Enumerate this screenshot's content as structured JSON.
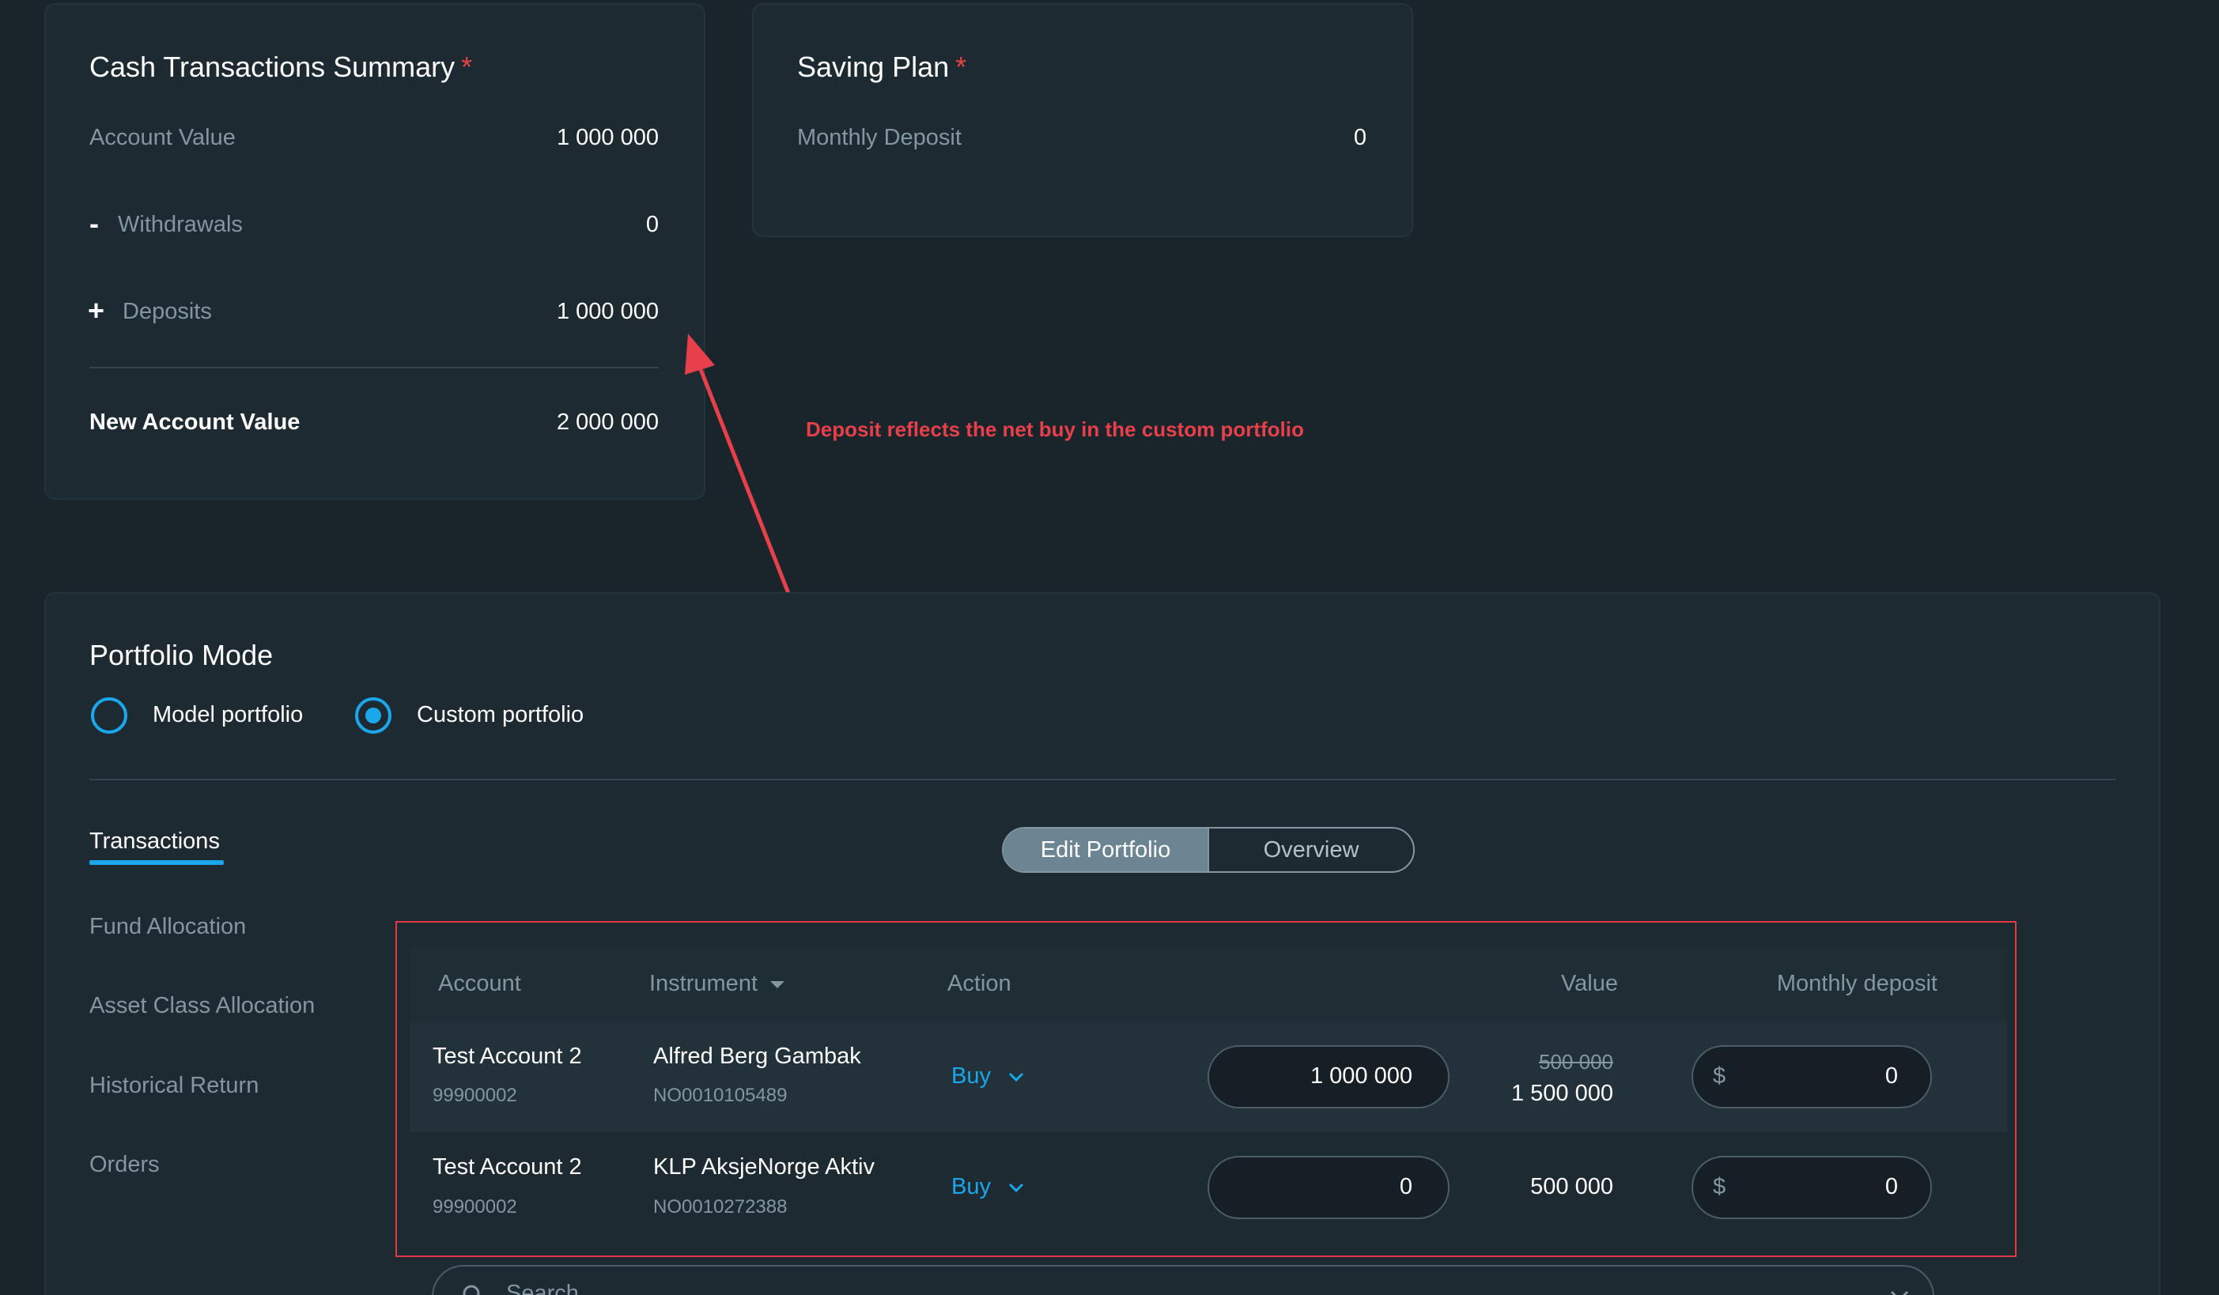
{
  "cash_summary": {
    "title": "Cash Transactions Summary",
    "required_mark": "*",
    "account_value_label": "Account Value",
    "account_value": "1 000 000",
    "withdrawals_sign": "-",
    "withdrawals_label": "Withdrawals",
    "withdrawals_value": "0",
    "deposits_sign": "+",
    "deposits_label": "Deposits",
    "deposits_value": "1 000 000",
    "new_account_value_label": "New Account Value",
    "new_account_value": "2 000 000"
  },
  "saving_plan": {
    "title": "Saving Plan",
    "required_mark": "*",
    "monthly_deposit_label": "Monthly Deposit",
    "monthly_deposit_value": "0"
  },
  "annotation": {
    "text": "Deposit reflects the net buy in the custom portfolio",
    "color": "#e8404a"
  },
  "portfolio_mode": {
    "title": "Portfolio Mode",
    "options": [
      {
        "label": "Model portfolio",
        "selected": false
      },
      {
        "label": "Custom portfolio",
        "selected": true
      }
    ]
  },
  "sidebar": {
    "items": [
      {
        "label": "Transactions",
        "active": true
      },
      {
        "label": "Fund Allocation",
        "active": false
      },
      {
        "label": "Asset Class Allocation",
        "active": false
      },
      {
        "label": "Historical Return",
        "active": false
      },
      {
        "label": "Orders",
        "active": false
      }
    ]
  },
  "view_toggle": {
    "edit_label": "Edit Portfolio",
    "overview_label": "Overview",
    "active": "Edit Portfolio"
  },
  "table": {
    "columns": [
      "Account",
      "Instrument",
      "Action",
      "Value",
      "Monthly deposit"
    ],
    "rows": [
      {
        "account_name": "Test Account 2",
        "account_number": "99900002",
        "instrument_name": "Alfred Berg Gambak",
        "instrument_isin": "NO0010105489",
        "action": "Buy",
        "amount": "1 000 000",
        "value_old": "500 000",
        "value": "1 500 000",
        "currency_prefix": "$",
        "monthly_deposit": "0"
      },
      {
        "account_name": "Test Account 2",
        "account_number": "99900002",
        "instrument_name": "KLP AksjeNorge Aktiv",
        "instrument_isin": "NO0010272388",
        "action": "Buy",
        "amount": "0",
        "value_old": "",
        "value": "500 000",
        "currency_prefix": "$",
        "monthly_deposit": "0"
      }
    ]
  },
  "search": {
    "placeholder": "Search"
  },
  "colors": {
    "accent": "#1aa7ec",
    "background": "#1a242b",
    "card": "#1d2a32",
    "highlight_frame": "#e13a44"
  }
}
